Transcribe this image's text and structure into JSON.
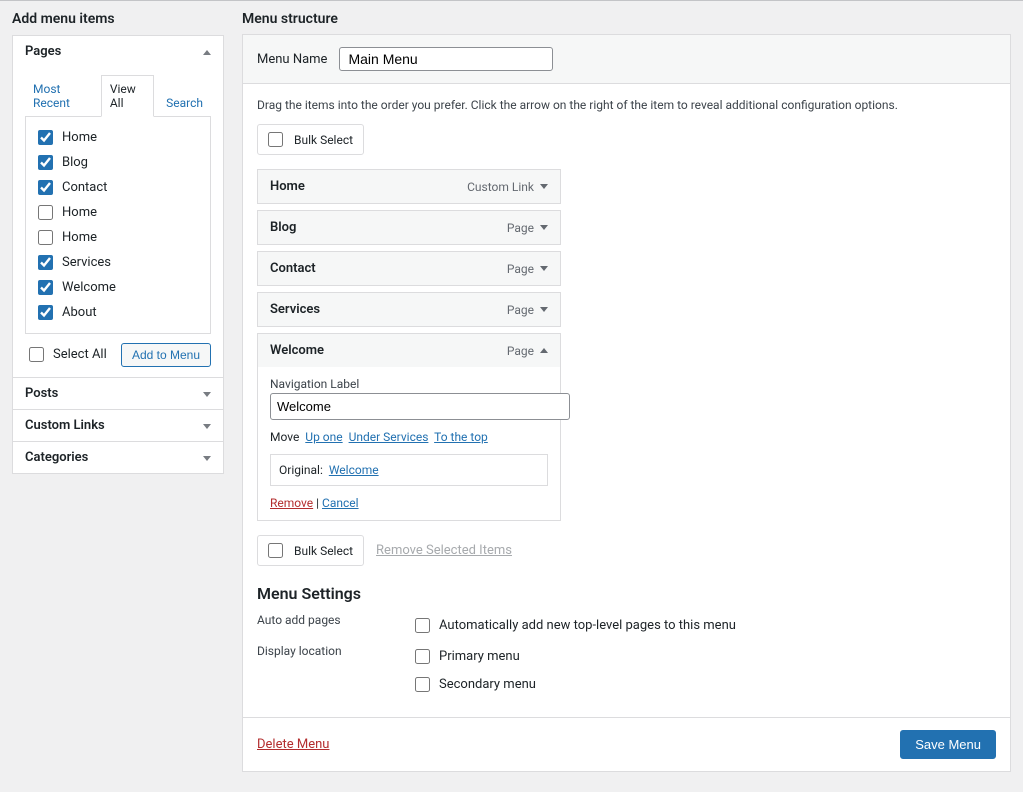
{
  "left": {
    "heading": "Add menu items",
    "sections": {
      "pages": {
        "title": "Pages",
        "open": true,
        "tabs": [
          "Most Recent",
          "View All",
          "Search"
        ],
        "activeTab": 1,
        "items": [
          {
            "label": "Home",
            "checked": true
          },
          {
            "label": "Blog",
            "checked": true
          },
          {
            "label": "Contact",
            "checked": true
          },
          {
            "label": "Home",
            "checked": false
          },
          {
            "label": "Home",
            "checked": false
          },
          {
            "label": "Services",
            "checked": true
          },
          {
            "label": "Welcome",
            "checked": true
          },
          {
            "label": "About",
            "checked": true
          }
        ],
        "selectAll": "Select All",
        "addToMenu": "Add to Menu"
      },
      "posts": {
        "title": "Posts"
      },
      "customLinks": {
        "title": "Custom Links"
      },
      "categories": {
        "title": "Categories"
      }
    }
  },
  "right": {
    "heading": "Menu structure",
    "menuNameLabel": "Menu Name",
    "menuName": "Main Menu",
    "dragHint": "Drag the items into the order you prefer. Click the arrow on the right of the item to reveal additional configuration options.",
    "bulkSelect": "Bulk Select",
    "removeSelected": "Remove Selected Items",
    "items": [
      {
        "title": "Home",
        "type": "Custom Link",
        "open": false
      },
      {
        "title": "Blog",
        "type": "Page",
        "open": false
      },
      {
        "title": "Contact",
        "type": "Page",
        "open": false
      },
      {
        "title": "Services",
        "type": "Page",
        "open": false
      },
      {
        "title": "Welcome",
        "type": "Page",
        "open": true,
        "navLabelField": "Navigation Label",
        "navLabel": "Welcome",
        "moveLabel": "Move",
        "moveLinks": [
          "Up one",
          "Under Services",
          "To the top"
        ],
        "originalLabel": "Original:",
        "originalLink": "Welcome",
        "remove": "Remove",
        "cancel": "Cancel"
      }
    ],
    "settings": {
      "heading": "Menu Settings",
      "autoAddLabel": "Auto add pages",
      "autoAddOption": "Automatically add new top-level pages to this menu",
      "displayLabel": "Display location",
      "locations": [
        "Primary menu",
        "Secondary menu"
      ]
    },
    "deleteMenu": "Delete Menu",
    "saveMenu": "Save Menu"
  }
}
